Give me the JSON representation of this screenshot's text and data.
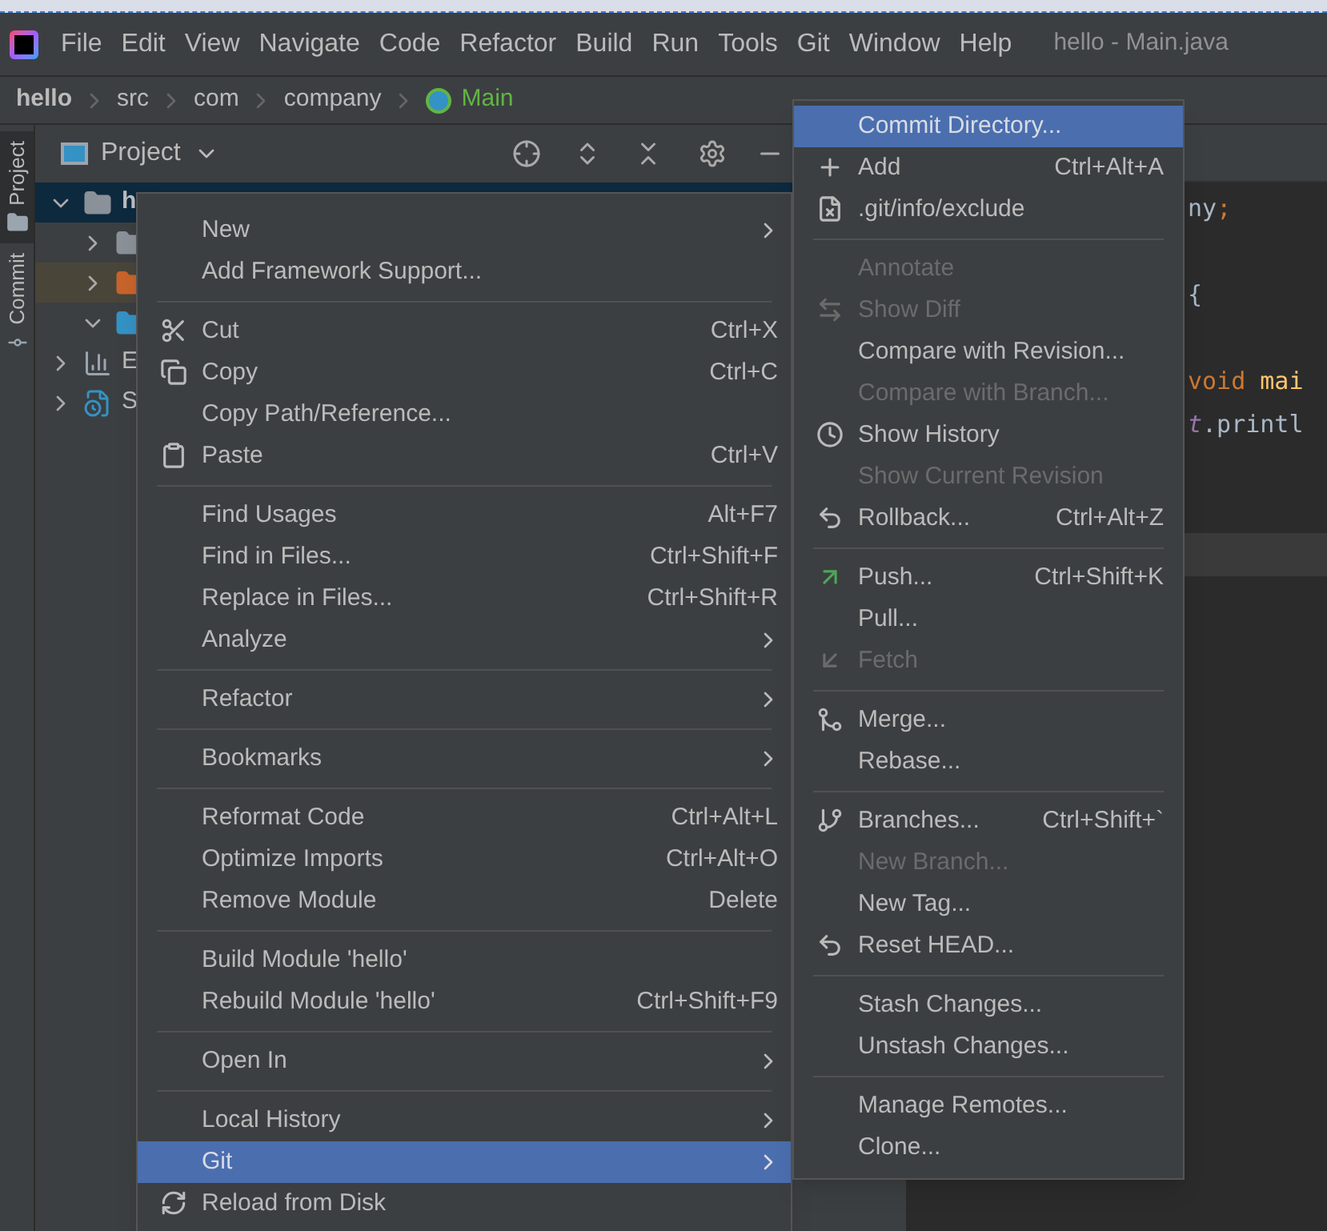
{
  "menubar": {
    "items": [
      "File",
      "Edit",
      "View",
      "Navigate",
      "Code",
      "Refactor",
      "Build",
      "Run",
      "Tools",
      "Git",
      "Window",
      "Help"
    ],
    "title": "hello - Main.java"
  },
  "breadcrumb": [
    {
      "label": "hello",
      "kind": "project"
    },
    {
      "label": "src",
      "kind": "folder"
    },
    {
      "label": "com",
      "kind": "folder"
    },
    {
      "label": "company",
      "kind": "folder"
    },
    {
      "label": "Main",
      "kind": "class"
    }
  ],
  "tool_strip": [
    {
      "label": "Project",
      "kind": "project",
      "selected": true
    },
    {
      "label": "Commit",
      "kind": "commit",
      "selected": false
    }
  ],
  "project_panel": {
    "title": "Project",
    "tree": [
      {
        "label": "h",
        "kind": "module",
        "expanded": true,
        "selected": true,
        "highlighted": false,
        "children": [
          {
            "kind": "folder",
            "expanded": false,
            "selected": false,
            "highlighted": false
          },
          {
            "kind": "excluded-folder",
            "expanded": false,
            "selected": false,
            "highlighted": true
          },
          {
            "kind": "source-folder",
            "expanded": true,
            "selected": false,
            "highlighted": false
          }
        ]
      },
      {
        "label": "E",
        "kind": "libraries",
        "expanded": false,
        "selected": false,
        "highlighted": false
      },
      {
        "label": "S",
        "kind": "scratches",
        "expanded": false,
        "selected": false,
        "highlighted": false
      }
    ]
  },
  "editor": {
    "code_lines": [
      {
        "kind": "code",
        "segments": [
          {
            "text": "ny",
            "kind": "plain"
          },
          {
            "text": ";",
            "kind": "keyword"
          }
        ]
      },
      {
        "kind": "blank"
      },
      {
        "kind": "code",
        "segments": [
          {
            "text": "{",
            "kind": "plain"
          }
        ]
      },
      {
        "kind": "blank"
      },
      {
        "kind": "code",
        "segments": [
          {
            "text": "void ",
            "kind": "keyword"
          },
          {
            "text": "mai",
            "kind": "method"
          }
        ]
      },
      {
        "kind": "code",
        "segments": [
          {
            "text": "t",
            "kind": "field"
          },
          {
            "text": ".printl",
            "kind": "plain"
          }
        ]
      },
      {
        "kind": "blank"
      },
      {
        "kind": "blank"
      },
      {
        "kind": "blank",
        "current": true
      }
    ]
  },
  "context_menu": {
    "items": [
      {
        "kind": "plain",
        "label": "New",
        "submenu": true,
        "selected": false,
        "disabled": false
      },
      {
        "kind": "plain",
        "label": "Add Framework Support...",
        "submenu": false,
        "selected": false,
        "disabled": false
      },
      {
        "kind": "separator"
      },
      {
        "kind": "cut",
        "label": "Cut",
        "shortcut": "Ctrl+X",
        "submenu": false,
        "selected": false,
        "disabled": false
      },
      {
        "kind": "copy",
        "label": "Copy",
        "shortcut": "Ctrl+C",
        "submenu": false,
        "selected": false,
        "disabled": false
      },
      {
        "kind": "plain",
        "label": "Copy Path/Reference...",
        "submenu": false,
        "selected": false,
        "disabled": false
      },
      {
        "kind": "paste",
        "label": "Paste",
        "shortcut": "Ctrl+V",
        "submenu": false,
        "selected": false,
        "disabled": false
      },
      {
        "kind": "separator"
      },
      {
        "kind": "plain",
        "label": "Find Usages",
        "shortcut": "Alt+F7",
        "submenu": false,
        "selected": false,
        "disabled": false
      },
      {
        "kind": "plain",
        "label": "Find in Files...",
        "shortcut": "Ctrl+Shift+F",
        "submenu": false,
        "selected": false,
        "disabled": false
      },
      {
        "kind": "plain",
        "label": "Replace in Files...",
        "shortcut": "Ctrl+Shift+R",
        "submenu": false,
        "selected": false,
        "disabled": false
      },
      {
        "kind": "plain",
        "label": "Analyze",
        "submenu": true,
        "selected": false,
        "disabled": false
      },
      {
        "kind": "separator"
      },
      {
        "kind": "plain",
        "label": "Refactor",
        "submenu": true,
        "selected": false,
        "disabled": false
      },
      {
        "kind": "separator"
      },
      {
        "kind": "plain",
        "label": "Bookmarks",
        "submenu": true,
        "selected": false,
        "disabled": false
      },
      {
        "kind": "separator"
      },
      {
        "kind": "plain",
        "label": "Reformat Code",
        "shortcut": "Ctrl+Alt+L",
        "submenu": false,
        "selected": false,
        "disabled": false
      },
      {
        "kind": "plain",
        "label": "Optimize Imports",
        "shortcut": "Ctrl+Alt+O",
        "submenu": false,
        "selected": false,
        "disabled": false
      },
      {
        "kind": "plain",
        "label": "Remove Module",
        "shortcut": "Delete",
        "submenu": false,
        "selected": false,
        "disabled": false
      },
      {
        "kind": "separator"
      },
      {
        "kind": "plain",
        "label": "Build Module 'hello'",
        "submenu": false,
        "selected": false,
        "disabled": false
      },
      {
        "kind": "plain",
        "label": "Rebuild Module 'hello'",
        "shortcut": "Ctrl+Shift+F9",
        "submenu": false,
        "selected": false,
        "disabled": false
      },
      {
        "kind": "separator"
      },
      {
        "kind": "plain",
        "label": "Open In",
        "submenu": true,
        "selected": false,
        "disabled": false
      },
      {
        "kind": "separator"
      },
      {
        "kind": "plain",
        "label": "Local History",
        "submenu": true,
        "selected": false,
        "disabled": false
      },
      {
        "kind": "plain",
        "label": "Git",
        "submenu": true,
        "selected": true,
        "disabled": false
      },
      {
        "kind": "reload",
        "label": "Reload from Disk",
        "submenu": false,
        "selected": false,
        "disabled": false
      }
    ]
  },
  "git_submenu": {
    "items": [
      {
        "kind": "plain",
        "label": "Commit Directory...",
        "selected": true,
        "disabled": false
      },
      {
        "kind": "add",
        "label": "Add",
        "shortcut": "Ctrl+Alt+A",
        "selected": false,
        "disabled": false
      },
      {
        "kind": "exclude",
        "label": ".git/info/exclude",
        "selected": false,
        "disabled": false
      },
      {
        "kind": "separator"
      },
      {
        "kind": "plain",
        "label": "Annotate",
        "selected": false,
        "disabled": true
      },
      {
        "kind": "diff",
        "label": "Show Diff",
        "selected": false,
        "disabled": true
      },
      {
        "kind": "plain",
        "label": "Compare with Revision...",
        "selected": false,
        "disabled": false
      },
      {
        "kind": "plain",
        "label": "Compare with Branch...",
        "selected": false,
        "disabled": true
      },
      {
        "kind": "history",
        "label": "Show History",
        "selected": false,
        "disabled": false
      },
      {
        "kind": "plain",
        "label": "Show Current Revision",
        "selected": false,
        "disabled": true
      },
      {
        "kind": "rollback",
        "label": "Rollback...",
        "shortcut": "Ctrl+Alt+Z",
        "selected": false,
        "disabled": false
      },
      {
        "kind": "separator"
      },
      {
        "kind": "push",
        "label": "Push...",
        "shortcut": "Ctrl+Shift+K",
        "selected": false,
        "disabled": false
      },
      {
        "kind": "plain",
        "label": "Pull...",
        "selected": false,
        "disabled": false
      },
      {
        "kind": "fetch",
        "label": "Fetch",
        "selected": false,
        "disabled": true
      },
      {
        "kind": "separator"
      },
      {
        "kind": "merge",
        "label": "Merge...",
        "selected": false,
        "disabled": false
      },
      {
        "kind": "plain",
        "label": "Rebase...",
        "selected": false,
        "disabled": false
      },
      {
        "kind": "separator"
      },
      {
        "kind": "branch",
        "label": "Branches...",
        "shortcut": "Ctrl+Shift+`",
        "selected": false,
        "disabled": false
      },
      {
        "kind": "plain",
        "label": "New Branch...",
        "selected": false,
        "disabled": true
      },
      {
        "kind": "plain",
        "label": "New Tag...",
        "selected": false,
        "disabled": false
      },
      {
        "kind": "rollback",
        "label": "Reset HEAD...",
        "selected": false,
        "disabled": false
      },
      {
        "kind": "separator"
      },
      {
        "kind": "plain",
        "label": "Stash Changes...",
        "selected": false,
        "disabled": false
      },
      {
        "kind": "plain",
        "label": "Unstash Changes...",
        "selected": false,
        "disabled": false
      },
      {
        "kind": "separator"
      },
      {
        "kind": "plain",
        "label": "Manage Remotes...",
        "selected": false,
        "disabled": false
      },
      {
        "kind": "plain",
        "label": "Clone...",
        "selected": false,
        "disabled": false
      }
    ]
  }
}
